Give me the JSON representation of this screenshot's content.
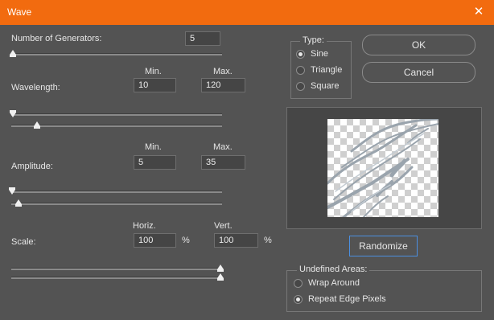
{
  "window": {
    "title": "Wave",
    "close_glyph": "✕"
  },
  "generators": {
    "label": "Number of Generators:",
    "value": "5"
  },
  "wavelength": {
    "label": "Wavelength:",
    "min_header": "Min.",
    "max_header": "Max.",
    "min": "10",
    "max": "120"
  },
  "amplitude": {
    "label": "Amplitude:",
    "min_header": "Min.",
    "max_header": "Max.",
    "min": "5",
    "max": "35"
  },
  "scale": {
    "label": "Scale:",
    "horiz_header": "Horiz.",
    "vert_header": "Vert.",
    "horiz": "100",
    "vert": "100",
    "unit": "%"
  },
  "type": {
    "legend": "Type:",
    "options": [
      "Sine",
      "Triangle",
      "Square"
    ],
    "selected": "Sine"
  },
  "buttons": {
    "ok": "OK",
    "cancel": "Cancel",
    "randomize": "Randomize"
  },
  "undefined_areas": {
    "legend": "Undefined Areas:",
    "options": [
      "Wrap Around",
      "Repeat Edge Pixels"
    ],
    "selected": "Repeat Edge Pixels"
  }
}
